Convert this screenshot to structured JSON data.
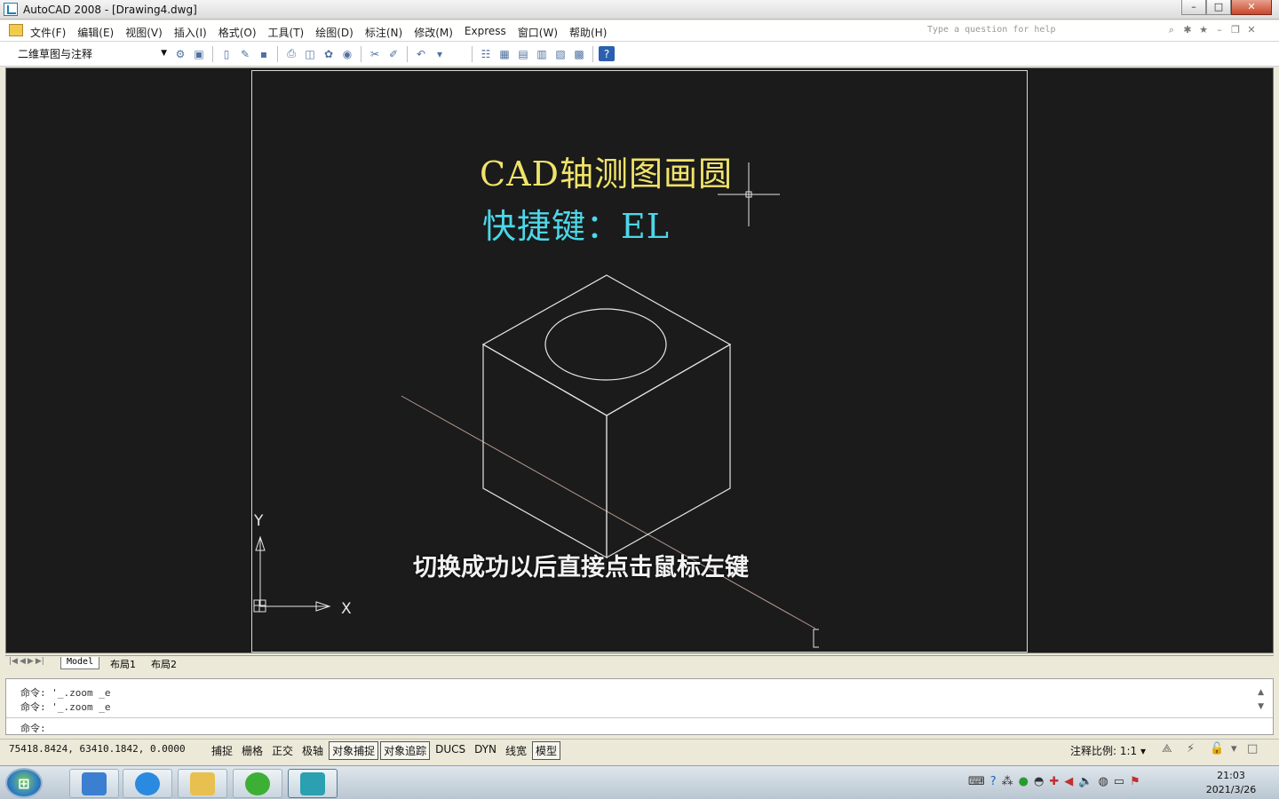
{
  "window": {
    "title": "AutoCAD 2008 - [Drawing4.dwg]",
    "controls": [
      "–",
      "□",
      "✕"
    ]
  },
  "menubar": {
    "items": [
      "文件(F)",
      "编辑(E)",
      "视图(V)",
      "插入(I)",
      "格式(O)",
      "工具(T)",
      "绘图(D)",
      "标注(N)",
      "修改(M)",
      "Express",
      "窗口(W)",
      "帮助(H)"
    ],
    "help_placeholder": "Type a question for help"
  },
  "toolbar": {
    "workspace": "二维草图与注释"
  },
  "canvas": {
    "title_text": "CAD轴测图画圆",
    "shortcut_text": "快捷键：EL",
    "caption": "切换成功以后直接点击鼠标左键",
    "ucs_y": "Y",
    "ucs_x": "X"
  },
  "tabs": {
    "model": "Model",
    "layout1": "布局1",
    "layout2": "布局2"
  },
  "command": {
    "history": [
      "命令: '_.zoom _e",
      "命令: '_.zoom _e"
    ],
    "prompt": "命令:"
  },
  "status": {
    "coords": "75418.8424,  63410.1842,  0.0000",
    "toggles": [
      {
        "label": "捕捉",
        "on": false
      },
      {
        "label": "栅格",
        "on": false
      },
      {
        "label": "正交",
        "on": false
      },
      {
        "label": "极轴",
        "on": false
      },
      {
        "label": "对象捕捉",
        "on": true
      },
      {
        "label": "对象追踪",
        "on": true
      },
      {
        "label": "DUCS",
        "on": false
      },
      {
        "label": "DYN",
        "on": false
      },
      {
        "label": "线宽",
        "on": false
      },
      {
        "label": "模型",
        "on": true
      }
    ],
    "annotation_scale_label": "注释比例:",
    "annotation_scale_value": "1:1"
  },
  "taskbar": {
    "time": "21:03",
    "date": "2021/3/26"
  },
  "colors": {
    "title_text": "#f0e36a",
    "shortcut_text": "#4cd7e8",
    "canvas_bg": "#1b1b1b"
  }
}
